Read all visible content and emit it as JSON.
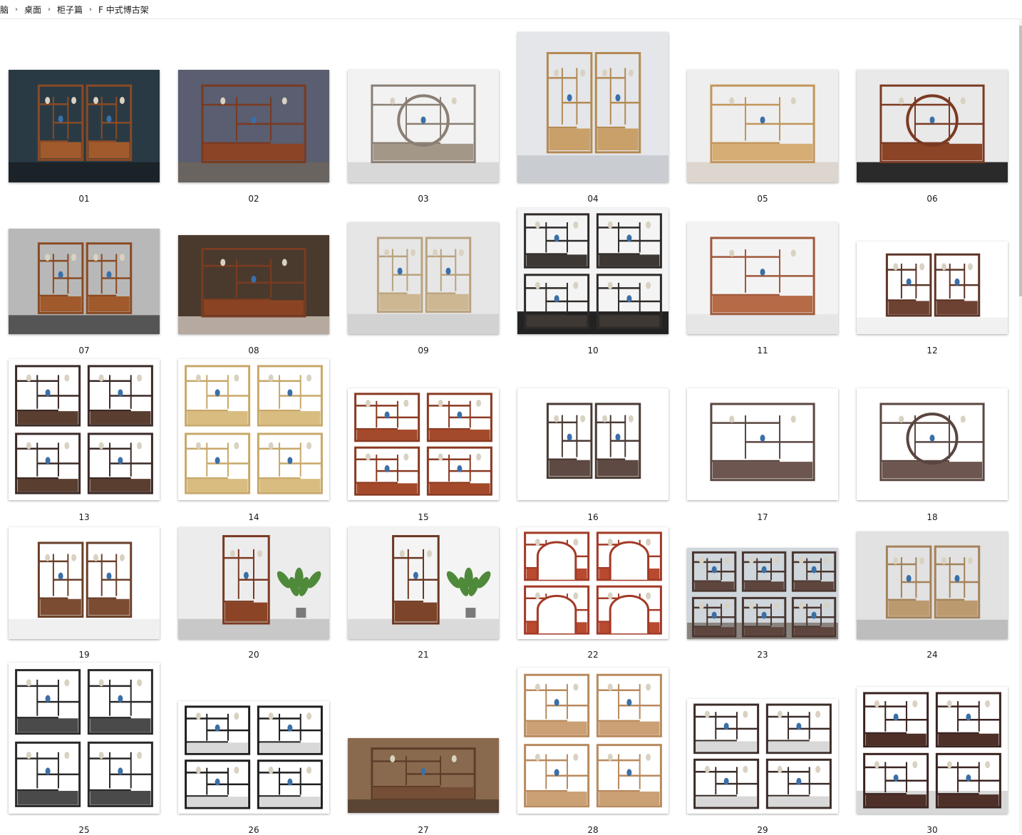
{
  "breadcrumb": {
    "items": [
      "脑",
      "桌面",
      "柜子篇",
      "F 中式博古架"
    ],
    "separator": "›"
  },
  "items": [
    {
      "label": "01",
      "style": {
        "bg": "#2a3a44",
        "floor": "#1b2328",
        "wood": "#8a4a24",
        "panel": "#a05a2c",
        "kind": "shelf-pair"
      }
    },
    {
      "label": "02",
      "style": {
        "bg": "#5a5e70",
        "floor": "#6a6460",
        "wood": "#7a3a20",
        "panel": "#8c4426",
        "kind": "cabinet"
      }
    },
    {
      "label": "03",
      "style": {
        "bg": "#f2f2f2",
        "floor": "#d8d8d8",
        "wood": "#8a7f74",
        "panel": "#a39788",
        "kind": "moongate"
      }
    },
    {
      "label": "04",
      "style": {
        "bg": "#e4e6ea",
        "floor": "#c9cdd2",
        "wood": "#b48a52",
        "panel": "#c9a06a",
        "kind": "shelf-pair"
      }
    },
    {
      "label": "05",
      "style": {
        "bg": "#eeeeee",
        "floor": "#dcd6ce",
        "wood": "#c2955a",
        "panel": "#d6ad74",
        "kind": "cabinet"
      }
    },
    {
      "label": "06",
      "style": {
        "bg": "#e9e9e9",
        "floor": "#2a2a2a",
        "wood": "#7a3a22",
        "panel": "#8c4426",
        "kind": "round"
      }
    },
    {
      "label": "07",
      "style": {
        "bg": "#b8b8b8",
        "floor": "#555555",
        "wood": "#8a4a22",
        "panel": "#a05a2c",
        "kind": "shelf-pair"
      }
    },
    {
      "label": "08",
      "style": {
        "bg": "#4a3a2e",
        "floor": "#b6aaa0",
        "wood": "#7a3c20",
        "panel": "#8a4424",
        "kind": "cabinet"
      }
    },
    {
      "label": "09",
      "style": {
        "bg": "#e6e6e6",
        "floor": "#d2d2d2",
        "wood": "#b9a27e",
        "panel": "#cdb792",
        "kind": "shelf-pair"
      }
    },
    {
      "label": "10",
      "style": {
        "bg": "#f4f4f4",
        "floor": "#222222",
        "wood": "#2e2a28",
        "panel": "#3e3834",
        "kind": "quad"
      }
    },
    {
      "label": "11",
      "style": {
        "bg": "#f3f3f3",
        "floor": "#e6e6e6",
        "wood": "#a0583a",
        "panel": "#b66a46",
        "kind": "cabinet"
      }
    },
    {
      "label": "12",
      "style": {
        "bg": "#ffffff",
        "floor": "#f1f1f1",
        "wood": "#5c3426",
        "panel": "#6e4232",
        "kind": "shelf-pair"
      }
    },
    {
      "label": "13",
      "style": {
        "bg": "#ffffff",
        "floor": "#ffffff",
        "wood": "#3a2a26",
        "panel": "#5a3e30",
        "kind": "quad"
      }
    },
    {
      "label": "14",
      "style": {
        "bg": "#ffffff",
        "floor": "#ffffff",
        "wood": "#c8a86a",
        "panel": "#d8bc80",
        "kind": "quad"
      }
    },
    {
      "label": "15",
      "style": {
        "bg": "#ffffff",
        "floor": "#ffffff",
        "wood": "#8a3a22",
        "panel": "#a44a2a",
        "kind": "quad"
      }
    },
    {
      "label": "16",
      "style": {
        "bg": "#ffffff",
        "floor": "#ffffff",
        "wood": "#4a3a34",
        "panel": "#5e4a42",
        "kind": "shelf-pair"
      }
    },
    {
      "label": "17",
      "style": {
        "bg": "#ffffff",
        "floor": "#ffffff",
        "wood": "#5a4640",
        "panel": "#6e5650",
        "kind": "cabinet"
      }
    },
    {
      "label": "18",
      "style": {
        "bg": "#ffffff",
        "floor": "#ffffff",
        "wood": "#5a4640",
        "panel": "#6e5650",
        "kind": "moongate"
      }
    },
    {
      "label": "19",
      "style": {
        "bg": "#ffffff",
        "floor": "#f0f0f0",
        "wood": "#6a4028",
        "panel": "#7c4c32",
        "kind": "shelf-pair"
      }
    },
    {
      "label": "20",
      "style": {
        "bg": "#ececec",
        "floor": "#c8c8c8",
        "wood": "#7a3a22",
        "panel": "#8c4426",
        "kind": "single-plant"
      }
    },
    {
      "label": "21",
      "style": {
        "bg": "#f4f4f4",
        "floor": "#dadada",
        "wood": "#6a3822",
        "panel": "#7c4428",
        "kind": "single-plant"
      }
    },
    {
      "label": "22",
      "style": {
        "bg": "#ffffff",
        "floor": "#ffffff",
        "wood": "#a23a26",
        "panel": "#b84a30",
        "kind": "arch-quad"
      }
    },
    {
      "label": "23",
      "style": {
        "bg": "#cfd6dc",
        "floor": "#8a8480",
        "wood": "#4a3630",
        "panel": "#5e463e",
        "kind": "six"
      }
    },
    {
      "label": "24",
      "style": {
        "bg": "#e2e2e2",
        "floor": "#bdbdbd",
        "wood": "#a4825a",
        "panel": "#bc9a70",
        "kind": "shelf-pair"
      }
    },
    {
      "label": "25",
      "style": {
        "bg": "#ffffff",
        "floor": "#ffffff",
        "wood": "#2a2a2a",
        "panel": "#4a4a4a",
        "kind": "quad"
      }
    },
    {
      "label": "26",
      "style": {
        "bg": "#ffffff",
        "floor": "#ffffff",
        "wood": "#1e1e1e",
        "panel": "#d8d8d8",
        "kind": "quad"
      }
    },
    {
      "label": "27",
      "style": {
        "bg": "#8a6a4e",
        "floor": "#5a4434",
        "wood": "#5e3e2a",
        "panel": "#744e36",
        "kind": "cabinet"
      }
    },
    {
      "label": "28",
      "style": {
        "bg": "#ffffff",
        "floor": "#ffffff",
        "wood": "#b88a5e",
        "panel": "#caa074",
        "kind": "quad"
      }
    },
    {
      "label": "29",
      "style": {
        "bg": "#ffffff",
        "floor": "#ffffff",
        "wood": "#3a2c28",
        "panel": "#d8d8d8",
        "kind": "quad"
      }
    },
    {
      "label": "30",
      "style": {
        "bg": "#ffffff",
        "floor": "#d8d8d8",
        "wood": "#3a2420",
        "panel": "#4e3028",
        "kind": "quad"
      }
    }
  ]
}
